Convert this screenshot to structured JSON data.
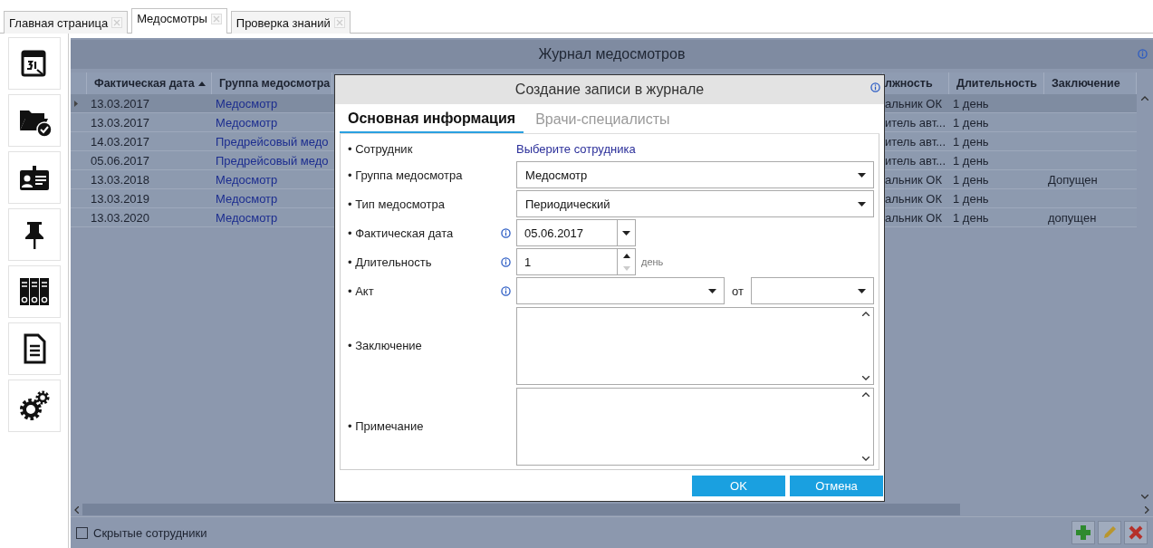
{
  "tabs": [
    {
      "label": "Главная страница",
      "selected": false
    },
    {
      "label": "Медосмотры",
      "selected": true
    },
    {
      "label": "Проверка знаний",
      "selected": false
    }
  ],
  "journal": {
    "title": "Журнал медосмотров",
    "columns": [
      {
        "label": "Фактическая дата",
        "sorted": true
      },
      {
        "label": "Группа медосмотра",
        "sorted": false
      },
      {
        "label": "лжность",
        "sorted": false
      },
      {
        "label": "Длительность",
        "sorted": false
      },
      {
        "label": "Заключение",
        "sorted": false
      }
    ],
    "rows": [
      {
        "selected": true,
        "cells": [
          "13.03.2017",
          "Медосмотр",
          "альник ОК",
          "1 день"
        ]
      },
      {
        "selected": false,
        "cells": [
          "13.03.2017",
          "Медосмотр",
          "итель авт...",
          "1 день"
        ]
      },
      {
        "selected": false,
        "cells": [
          "14.03.2017",
          "Предрейсовый медо",
          "итель авт...",
          "1 день"
        ]
      },
      {
        "selected": false,
        "cells": [
          "05.06.2017",
          "Предрейсовый медо",
          "итель авт...",
          "1 день"
        ]
      },
      {
        "selected": false,
        "cells": [
          "13.03.2018",
          "Медосмотр",
          "альник ОК",
          "1 день",
          "Допущен"
        ]
      },
      {
        "selected": false,
        "cells": [
          "13.03.2019",
          "Медосмотр",
          "альник ОК",
          "1 день"
        ]
      },
      {
        "selected": false,
        "cells": [
          "13.03.2020",
          "Медосмотр",
          "альник ОК",
          "1 день",
          "допущен"
        ]
      }
    ]
  },
  "dialog": {
    "title": "Создание записи в журнале",
    "tabs": [
      {
        "label": "Основная информация",
        "selected": true
      },
      {
        "label": "Врачи-специалисты",
        "selected": false
      }
    ],
    "fields": [
      {
        "kind": "link",
        "label": "• Сотрудник",
        "info": false,
        "value": "Выберите сотрудника"
      },
      {
        "kind": "select",
        "label": "• Группа медосмотра",
        "info": false,
        "value": "Медосмотр"
      },
      {
        "kind": "select",
        "label": "• Тип медосмотра",
        "info": false,
        "value": "Периодический"
      },
      {
        "kind": "date",
        "label": "• Фактическая дата",
        "info": true,
        "value": "05.06.2017"
      },
      {
        "kind": "number",
        "label": "• Длительность",
        "info": true,
        "value": "1",
        "unit": "день"
      },
      {
        "kind": "act",
        "label": "• Акт",
        "info": true,
        "joiner": "от"
      },
      {
        "kind": "memo",
        "label": "• Заключение",
        "info": false
      },
      {
        "kind": "memo",
        "label": "• Примечание",
        "info": false
      }
    ],
    "buttons": [
      "OK",
      "Отмена"
    ]
  },
  "footer": {
    "hidden_employees": {
      "label": "Скрытые сотрудники",
      "checked": false
    }
  }
}
